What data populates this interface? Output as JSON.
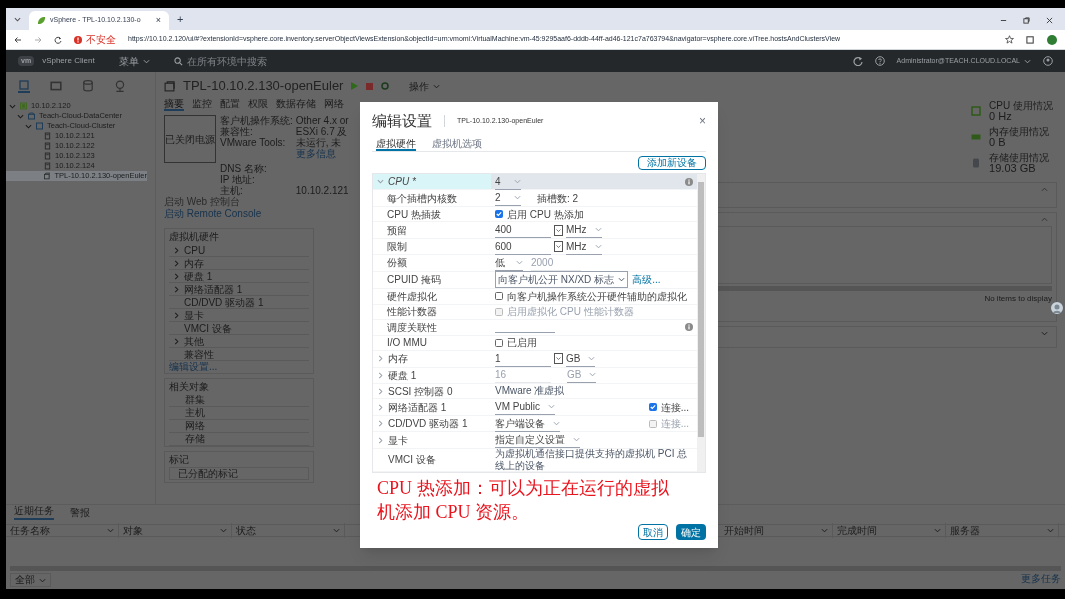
{
  "browser": {
    "tab": {
      "title": "vSphere - TPL-10.10.2.130-o",
      "close": "×"
    },
    "new_tab": "+",
    "security": "不安全",
    "url": "https://10.10.2.120/ui/#?extensionId=vsphere.core.inventory.serverObjectViewsExtension&objectId=urn:vmomi:VirtualMachine:vm-45:9295aaf6-dddb-44ff-ad46-121c7a763794&navigator=vsphere.core.viTree.hostsAndClustersView"
  },
  "header": {
    "logo": "vm",
    "product": "vSphere Client",
    "menu": "菜单",
    "search_placeholder": "在所有环境中搜索",
    "user": "Administrator@TEACH.CLOUD.LOCAL"
  },
  "navigator_tabs": [
    {
      "kind": "hosts",
      "selected": true
    },
    {
      "kind": "vms",
      "selected": false
    },
    {
      "kind": "storage",
      "selected": false
    },
    {
      "kind": "network",
      "selected": false
    }
  ],
  "tree": [
    {
      "label": "10.10.2.120",
      "kind": "vcenter",
      "selected": false,
      "expanded": true,
      "children": [
        {
          "label": "Teach-Cloud-DataCenter",
          "kind": "datacenter",
          "selected": false,
          "expanded": true,
          "children": [
            {
              "label": "Teach-Cloud-Cluster",
              "kind": "cluster",
              "selected": false,
              "expanded": true,
              "children": [
                {
                  "label": "10.10.2.121",
                  "kind": "host",
                  "selected": false
                },
                {
                  "label": "10.10.2.122",
                  "kind": "host",
                  "selected": false
                },
                {
                  "label": "10.10.2.123",
                  "kind": "host",
                  "selected": false
                },
                {
                  "label": "10.10.2.124",
                  "kind": "host",
                  "selected": false
                },
                {
                  "label": "TPL-10.10.2.130-openEuler",
                  "kind": "vm",
                  "selected": true
                }
              ]
            }
          ]
        }
      ]
    }
  ],
  "vm": {
    "title": "TPL-10.10.2.130-openEuler",
    "actions": "操作",
    "tabs": [
      {
        "label": "摘要",
        "selected": true
      },
      {
        "label": "监控",
        "selected": false
      },
      {
        "label": "配置",
        "selected": false
      },
      {
        "label": "权限",
        "selected": false
      },
      {
        "label": "数据存储",
        "selected": false
      },
      {
        "label": "网络",
        "selected": false
      }
    ],
    "power_state": "已关闭电源",
    "properties": [
      {
        "label": "客户机操作系统:",
        "value": "Other 4.x or"
      },
      {
        "label": "兼容性:",
        "value": "ESXi 6.7 及"
      },
      {
        "label": "VMware Tools:",
        "value": "未运行, 未"
      },
      {
        "label": "DNS 名称:"
      },
      {
        "label": "IP 地址:"
      },
      {
        "label": "主机:",
        "value": "10.10.2.121"
      }
    ],
    "more_info": "更多信息",
    "web_console": "启动 Web 控制台",
    "remote_console": "启动 Remote Console",
    "usage": [
      {
        "kind": "cpu",
        "label": "CPU 使用情况",
        "value": "0 Hz"
      },
      {
        "kind": "memory",
        "label": "内存使用情况",
        "value": "0 B"
      },
      {
        "kind": "storage",
        "label": "存储使用情况",
        "value": "19.03 GB"
      }
    ]
  },
  "hardware_panel": {
    "title": "虚拟机硬件",
    "items": [
      {
        "label": "CPU",
        "expandable": true
      },
      {
        "label": "内存",
        "expandable": true
      },
      {
        "label": "硬盘 1",
        "expandable": true
      },
      {
        "label": "网络适配器 1",
        "expandable": true
      },
      {
        "label": "CD/DVD 驱动器 1",
        "expandable": false
      },
      {
        "label": "显卡",
        "expandable": true
      },
      {
        "label": "VMCI 设备",
        "expandable": false
      },
      {
        "label": "其他",
        "expandable": true
      },
      {
        "label": "兼容性",
        "expandable": false
      }
    ],
    "edit_link": "编辑设置..."
  },
  "related_objects": {
    "title": "相关对象",
    "items": [
      "群集",
      "主机",
      "网络",
      "存储"
    ]
  },
  "tags_panel": {
    "title": "标记",
    "column_1": "已分配的标记"
  },
  "right_panel": {
    "empty_text": "No items to display"
  },
  "recent_tasks": {
    "tabs": [
      {
        "label": "近期任务",
        "selected": true
      },
      {
        "label": "警报",
        "selected": false
      }
    ],
    "columns": [
      "任务名称",
      "对象",
      "状态",
      "开始时间",
      "完成时间",
      "服务器"
    ],
    "filter": "全部",
    "more": "更多任务"
  },
  "dialog": {
    "title": "编辑设置",
    "subtitle": "TPL-10.10.2.130-openEuler",
    "close": "×",
    "tabs": [
      {
        "label": "虚拟硬件",
        "selected": true
      },
      {
        "label": "虚拟机选项",
        "selected": false
      }
    ],
    "add_device": "添加新设备",
    "rows": [
      {
        "label": "CPU *",
        "kind": "select",
        "value": "4",
        "expanded": true,
        "info": true,
        "children": [
          {
            "label": "每个插槽内核数",
            "kind": "select",
            "value": "2",
            "note": "插槽数: 2"
          },
          {
            "label": "CPU 热插拔",
            "kind": "checkbox",
            "checked": true,
            "disabled": false,
            "text": "启用 CPU 热添加"
          },
          {
            "label": "预留",
            "kind": "unit",
            "value": "400",
            "unit": "MHz",
            "disabled": false
          },
          {
            "label": "限制",
            "kind": "unit",
            "value": "600",
            "unit": "MHz",
            "disabled": false
          },
          {
            "label": "份额",
            "kind": "shares",
            "value": "低",
            "number": "2000"
          },
          {
            "label": "CPUID 掩码",
            "kind": "mask",
            "value": "向客户机公开 NX/XD 标志",
            "link": "高级..."
          },
          {
            "label": "硬件虚拟化",
            "kind": "checkbox",
            "checked": false,
            "disabled": false,
            "text": "向客户机操作系统公开硬件辅助的虚拟化"
          },
          {
            "label": "性能计数器",
            "kind": "checkbox",
            "checked": false,
            "disabled": true,
            "text": "启用虚拟化 CPU 性能计数器"
          },
          {
            "label": "调度关联性",
            "kind": "input",
            "info": true
          },
          {
            "label": "I/O MMU",
            "kind": "checkbox",
            "checked": false,
            "disabled": false,
            "text": "已启用"
          }
        ]
      },
      {
        "label": "内存",
        "kind": "unit",
        "value": "1",
        "unit": "GB",
        "disabled": false,
        "expanded": false
      },
      {
        "label": "硬盘 1",
        "kind": "unit",
        "value": "16",
        "unit": "GB",
        "disabled": true,
        "expanded": false
      },
      {
        "label": "SCSI 控制器 0",
        "kind": "text",
        "value": "VMware 准虚拟",
        "expanded": false
      },
      {
        "label": "网络适配器 1",
        "kind": "connect",
        "value": "VM Public",
        "checked": true,
        "disabled": false,
        "text": "连接...",
        "expanded": false
      },
      {
        "label": "CD/DVD 驱动器 1",
        "kind": "connect",
        "value": "客户端设备",
        "checked": false,
        "disabled": true,
        "text": "连接...",
        "expanded": false
      },
      {
        "label": "显卡",
        "kind": "select",
        "value": "指定自定义设置",
        "expanded": false
      },
      {
        "label": "VMCI 设备",
        "kind": "text",
        "value": "为虚拟机通信接口提供支持的虚拟机 PCI 总线上的设备"
      }
    ],
    "annotation": "CPU 热添加：可以为正在运行的虚拟机添加 CPU 资源。",
    "buttons": [
      {
        "label": "取消",
        "kind": "secondary"
      },
      {
        "label": "确定",
        "kind": "primary"
      }
    ]
  }
}
